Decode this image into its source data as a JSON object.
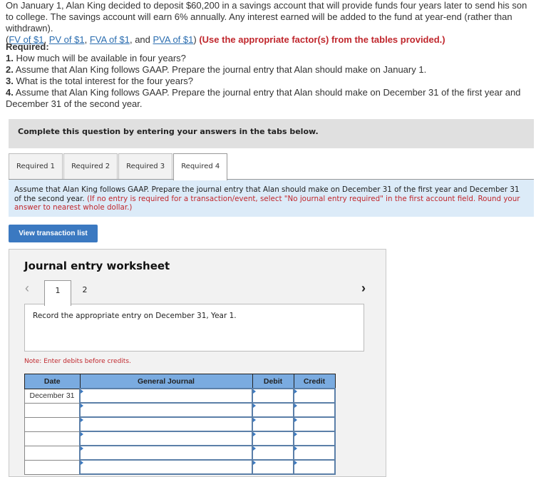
{
  "intro": {
    "text": "On January 1, Alan King decided to deposit $60,200 in a savings account that will provide funds four years later to send his son to college. The savings account will earn 6% annually. Any interest earned will be added to the fund at year-end (rather than withdrawn).",
    "open_paren": "(",
    "links": [
      "FV of $1",
      "PV of $1",
      "FVA of $1",
      "PVA of $1"
    ],
    "sep1": ", ",
    "sep_and": ", and ",
    "close_paren": ")",
    "instruction": "(Use the appropriate factor(s) from the tables provided.)"
  },
  "required": {
    "heading": "Required:",
    "items": [
      {
        "num": "1.",
        "text": "How much will be available in four years?"
      },
      {
        "num": "2.",
        "text": "Assume that Alan King follows GAAP. Prepare the journal entry that Alan should make on January 1."
      },
      {
        "num": "3.",
        "text": "What is the total interest for the four years?"
      },
      {
        "num": "4.",
        "text": "Assume that Alan King follows GAAP. Prepare the journal entry that Alan should make on December 31 of the first year and December 31 of the second year."
      }
    ]
  },
  "complete_banner": "Complete this question by entering your answers in the tabs below.",
  "tabs": [
    {
      "label": "Required 1",
      "active": false
    },
    {
      "label": "Required 2",
      "active": false
    },
    {
      "label": "Required 3",
      "active": false
    },
    {
      "label": "Required 4",
      "active": true
    }
  ],
  "instructions": {
    "text": "Assume that Alan King follows GAAP. Prepare the journal entry that Alan should make on December 31 of the first year and December 31 of the second year.",
    "note": "(If no entry is required for a transaction/event, select \"No journal entry required\" in the first account field. Round your answer to nearest whole dollar.)"
  },
  "view_transaction_button": "View transaction list",
  "worksheet": {
    "title": "Journal entry worksheet",
    "prev_icon": "‹",
    "next_icon": "›",
    "entry_tabs": [
      "1",
      "2"
    ],
    "active_entry": "1",
    "entry_prompt": "Record the appropriate entry on December 31, Year 1.",
    "note": "Note: Enter debits before credits.",
    "columns": [
      "Date",
      "General Journal",
      "Debit",
      "Credit"
    ],
    "rows": [
      {
        "date": "December 31",
        "account": "",
        "debit": "",
        "credit": ""
      },
      {
        "date": "",
        "account": "",
        "debit": "",
        "credit": ""
      },
      {
        "date": "",
        "account": "",
        "debit": "",
        "credit": ""
      },
      {
        "date": "",
        "account": "",
        "debit": "",
        "credit": ""
      },
      {
        "date": "",
        "account": "",
        "debit": "",
        "credit": ""
      },
      {
        "date": "",
        "account": "",
        "debit": "",
        "credit": ""
      }
    ]
  },
  "colors": {
    "accent_blue": "#3b79c1",
    "header_blue": "#7aabe0",
    "instruction_red": "#c0272d",
    "instruction_bg": "#dcebf8"
  }
}
